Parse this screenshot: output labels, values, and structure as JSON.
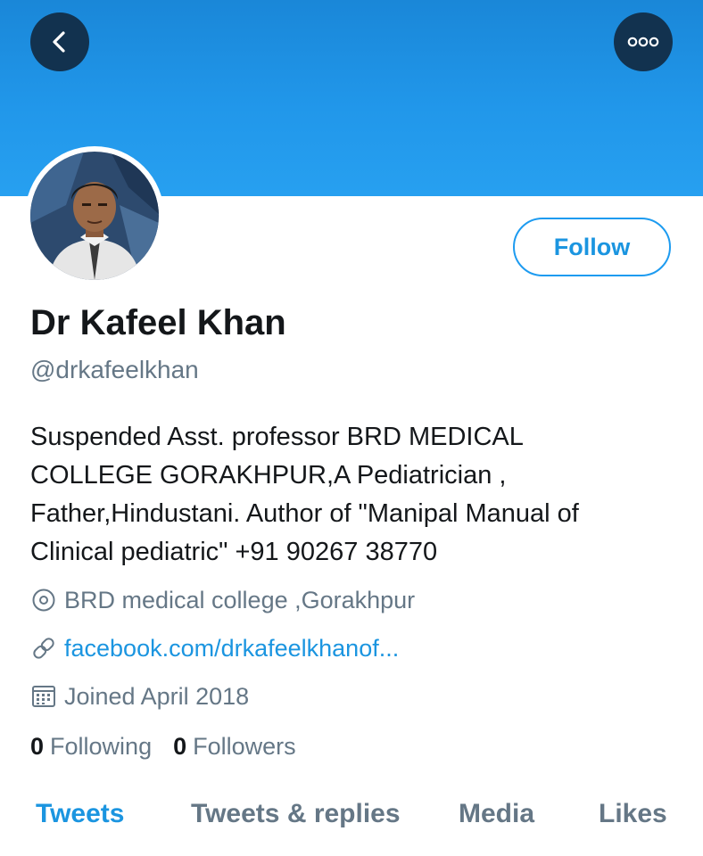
{
  "colors": {
    "accent": "#1b95e0",
    "banner": "#2197ea",
    "nav_button": "#12324f",
    "text_primary": "#14171a",
    "text_secondary": "#657786"
  },
  "header": {
    "back_icon": "chevron-left-icon",
    "more_icon": "ellipsis-icon"
  },
  "profile": {
    "avatar_icon": "profile-photo",
    "name": "Dr Kafeel Khan",
    "handle": "@drkafeelkhan",
    "follow_label": "Follow",
    "bio_lines": [
      "Suspended Asst. professor BRD MEDICAL",
      "COLLEGE GORAKHPUR,A Pediatrician ,",
      "Father,Hindustani. Author of \"Manipal Manual of",
      "Clinical pediatric\" +91 90267 38770"
    ],
    "location": "BRD medical college ,Gorakhpur",
    "location_icon": "location-pin-icon",
    "link": "facebook.com/drkafeelkhanof...",
    "link_icon": "link-icon",
    "joined": "Joined April 2018",
    "joined_icon": "calendar-icon"
  },
  "stats": {
    "following_count": "0",
    "following_label": "Following",
    "followers_count": "0",
    "followers_label": "Followers"
  },
  "tabs": [
    {
      "label": "Tweets",
      "active": true
    },
    {
      "label": "Tweets & replies",
      "active": false
    },
    {
      "label": "Media",
      "active": false
    },
    {
      "label": "Likes",
      "active": false
    }
  ]
}
